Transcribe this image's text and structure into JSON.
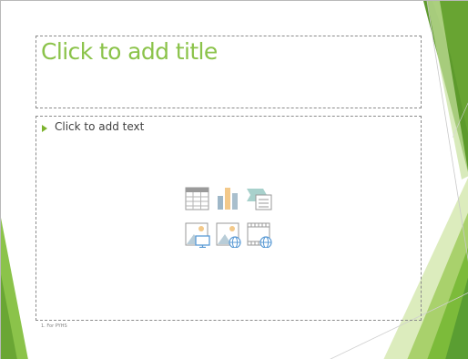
{
  "slide": {
    "title_placeholder": "Click to add title",
    "body_placeholder": "Click to add text",
    "footer": "1. For PYHS"
  },
  "content_icons": [
    {
      "name": "insert-table-icon"
    },
    {
      "name": "insert-chart-icon"
    },
    {
      "name": "insert-smartart-icon"
    },
    {
      "name": "insert-picture-icon"
    },
    {
      "name": "insert-online-picture-icon"
    },
    {
      "name": "insert-video-icon"
    }
  ],
  "colors": {
    "accent_green": "#8bc34a",
    "dark_green": "#5a9e32",
    "light_green": "#d3e7a8",
    "bullet_green": "#7cb32d"
  }
}
